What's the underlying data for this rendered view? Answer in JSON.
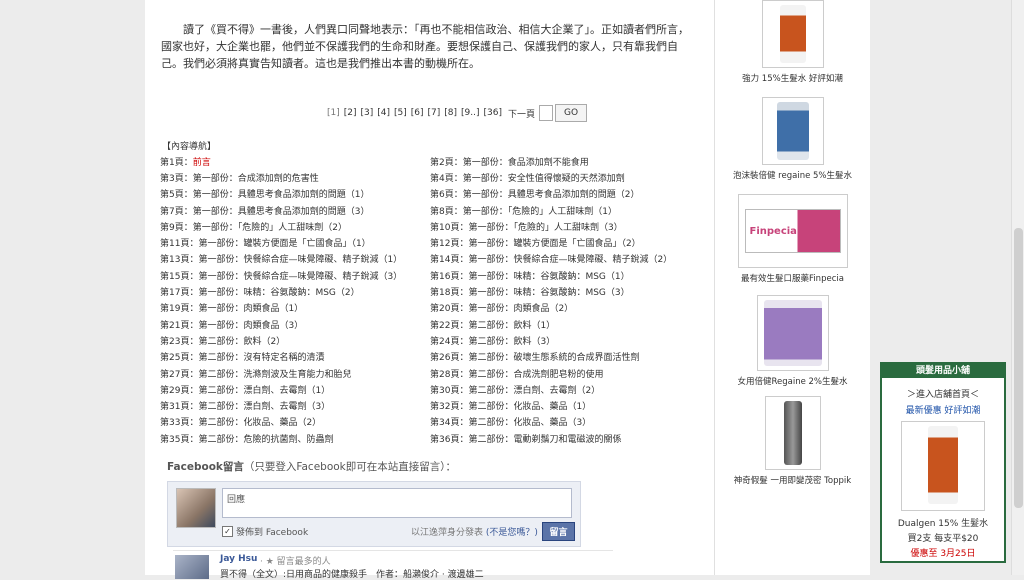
{
  "intro_text": "讀了《買不得》一書後，人們異口同聲地表示：「再也不能相信政治、相信大企業了」。正如讀者們所言，國家也好，大企業也罷，他們並不保護我們的生命和財產。要想保護自己、保護我們的家人，只有靠我們自己。我們必須將真實告知讀者。這也是我們推出本書的動機所在。",
  "pager": {
    "pages": [
      "[1]",
      "[2]",
      "[3]",
      "[4]",
      "[5]",
      "[6]",
      "[7]",
      "[8]",
      "[9..]",
      "[36]"
    ],
    "next_label": "下一頁",
    "go_label": "GO"
  },
  "toc": {
    "title": "【內容導航】",
    "rows": [
      [
        {
          "prefix": "第1頁：",
          "link": "前言"
        },
        {
          "prefix": "第2頁：",
          "link": "第一部份：食品添加劑不能食用"
        }
      ],
      [
        {
          "prefix": "第3頁：",
          "link": "第一部份：合成添加劑的危害性"
        },
        {
          "prefix": "第4頁：",
          "link": "第一部份：安全性值得懷疑的天然添加劑"
        }
      ],
      [
        {
          "prefix": "第5頁：",
          "link": "第一部份：具體思考食品添加劑的問題（1）"
        },
        {
          "prefix": "第6頁：",
          "link": "第一部份：具體思考食品添加劑的問題（2）"
        }
      ],
      [
        {
          "prefix": "第7頁：",
          "link": "第一部份：具體思考食品添加劑的問題（3）"
        },
        {
          "prefix": "第8頁：",
          "link": "第一部份：「危險的」人工甜味劑（1）"
        }
      ],
      [
        {
          "prefix": "第9頁：",
          "link": "第一部份：「危險的」人工甜味劑（2）"
        },
        {
          "prefix": "第10頁：",
          "link": "第一部份：「危險的」人工甜味劑（3）"
        }
      ],
      [
        {
          "prefix": "第11頁：",
          "link": "第一部份：罐裝方便面是「亡國食品」（1）"
        },
        {
          "prefix": "第12頁：",
          "link": "第一部份：罐裝方便面是「亡國食品」（2）"
        }
      ],
      [
        {
          "prefix": "第13頁：",
          "link": "第一部份：快餐綜合症—味覺障礙、精子銳減（1）"
        },
        {
          "prefix": "第14頁：",
          "link": "第一部份：快餐綜合症—味覺障礙、精子銳減（2）"
        }
      ],
      [
        {
          "prefix": "第15頁：",
          "link": "第一部份：快餐綜合症—味覺障礙、精子銳減（3）"
        },
        {
          "prefix": "第16頁：",
          "link": "第一部份：味精：谷氨酸鈉：MSG（1）"
        }
      ],
      [
        {
          "prefix": "第17頁：",
          "link": "第一部份：味精：谷氨酸鈉：MSG（2）"
        },
        {
          "prefix": "第18頁：",
          "link": "第一部份：味精：谷氨酸鈉：MSG（3）"
        }
      ],
      [
        {
          "prefix": "第19頁：",
          "link": "第一部份：肉類食品（1）"
        },
        {
          "prefix": "第20頁：",
          "link": "第一部份：肉類食品（2）"
        }
      ],
      [
        {
          "prefix": "第21頁：",
          "link": "第一部份：肉類食品（3）"
        },
        {
          "prefix": "第22頁：",
          "link": "第二部份：飲料（1）"
        }
      ],
      [
        {
          "prefix": "第23頁：",
          "link": "第二部份：飲料（2）"
        },
        {
          "prefix": "第24頁：",
          "link": "第二部份：飲料（3）"
        }
      ],
      [
        {
          "prefix": "第25頁：",
          "link": "第二部份：沒有特定名稱的清漬"
        },
        {
          "prefix": "第26頁：",
          "link": "第二部份：破壞生態系統的合成界面活性劑"
        }
      ],
      [
        {
          "prefix": "第27頁：",
          "link": "第二部份：洗滌劑波及生育能力和胎兒"
        },
        {
          "prefix": "第28頁：",
          "link": "第二部份：合成洗劑肥皂粉的使用"
        }
      ],
      [
        {
          "prefix": "第29頁：",
          "link": "第二部份：漂白劑、去霉劑（1）"
        },
        {
          "prefix": "第30頁：",
          "link": "第二部份：漂白劑、去霉劑（2）"
        }
      ],
      [
        {
          "prefix": "第31頁：",
          "link": "第二部份：漂白劑、去霉劑（3）"
        },
        {
          "prefix": "第32頁：",
          "link": "第二部份：化妝品、藥品（1）"
        }
      ],
      [
        {
          "prefix": "第33頁：",
          "link": "第二部份：化妝品、藥品（2）"
        },
        {
          "prefix": "第34頁：",
          "link": "第二部份：化妝品、藥品（3）"
        }
      ],
      [
        {
          "prefix": "第35頁：",
          "link": "第二部份：危險的抗菌劑、防蟲劑"
        },
        {
          "prefix": "第36頁：",
          "link": "第二部份：電動剃鬚刀和電磁波的關係"
        }
      ]
    ]
  },
  "facebook": {
    "title": "Facebook留言",
    "subtitle": "（只要登入Facebook即可在本站直接留言）：",
    "placeholder": "回應",
    "post_checkbox_label": "發佈到 Facebook",
    "posting_as": "以江逸萍身分發表",
    "not_you": "(不是您嗎？)",
    "post_button": "留言",
    "comment": {
      "name": "Jay Hsu",
      "meta": "· ★ 留言最多的人",
      "text": "買不得（全文）:日用商品的健康殺手　作者：船瀨俊介 · 渡邊雄二"
    }
  },
  "sidebar": {
    "products": [
      {
        "caption": "強力 15%生髮水 好評如潮"
      },
      {
        "caption": "泡沫裝倍健 regaine 5%生髮水"
      },
      {
        "caption": "最有效生髮口服藥Finpecia",
        "label": "Finpecia"
      },
      {
        "caption": "女用倍健Regaine 2%生髮水"
      },
      {
        "caption": "神奇假髮 一用即變茂密 Toppik"
      }
    ]
  },
  "adbox": {
    "header": "頭髮用品小舖",
    "line1": "＞進入店舖首頁＜",
    "line2": "最新優惠 好評如潮",
    "line3": "Dualgen 15% 生髮水",
    "line4": "買2支 每支平$20",
    "line5": "優惠至 3月25日"
  },
  "colors": {
    "link_red": "#cc0000",
    "fb_blue": "#3b5998",
    "ad_green": "#2a6b3f"
  }
}
